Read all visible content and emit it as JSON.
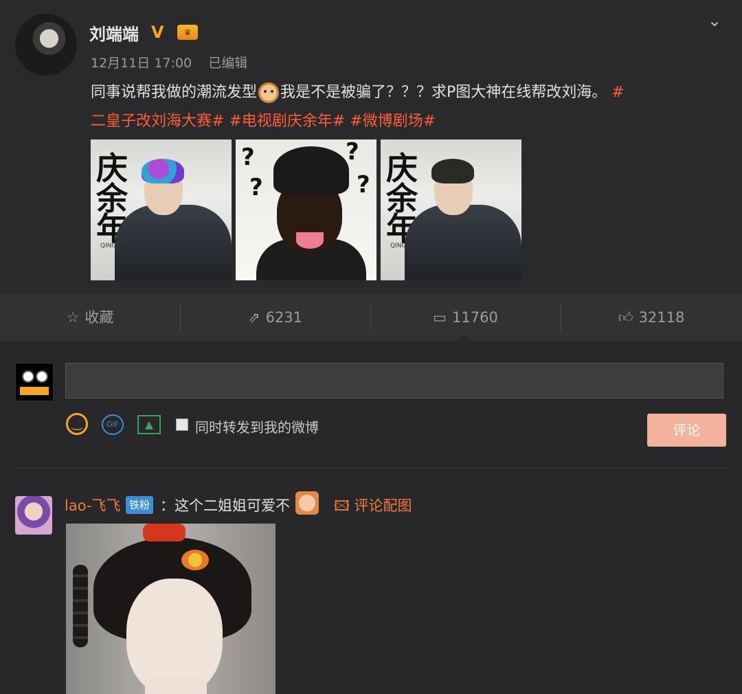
{
  "post": {
    "author": "刘端端",
    "verified_badge": "V",
    "time": "12月11日 17:00",
    "edited": "已编辑",
    "text_part1": "同事说帮我做的潮流发型",
    "text_part2": "我是不是被骗了？？？求P图大神在线帮改刘海。",
    "tag1_start": "#",
    "tag1_end": "二皇子改刘海大赛#",
    "tag2": "#电视剧庆余年#",
    "tag3": "#微博剧场#",
    "images": [
      {
        "calligraphy": "庆余年",
        "subtitle": "QING YU NIAN"
      },
      {
        "marks": [
          "?",
          "?",
          "?",
          "?"
        ]
      },
      {
        "calligraphy": "庆余年",
        "subtitle": "QING YU NIAN"
      }
    ]
  },
  "actions": {
    "favorite": "收藏",
    "repost": "6231",
    "comments": "11760",
    "likes": "32118"
  },
  "composer": {
    "placeholder": "",
    "avatar_label": "",
    "sync_label": "同时转发到我的微博",
    "submit": "评论",
    "gif_label": "GIF"
  },
  "comment": {
    "user": "lao-飞飞",
    "fan_badge": "铁粉",
    "separator": "：",
    "text": "这个二姐姐可爱不",
    "image_link": "评论配图"
  },
  "colors": {
    "accent": "#f47a3a",
    "tag": "#ff5d3a",
    "badge_blue": "#3e8ed6",
    "submit_bg": "#f2b29b"
  }
}
